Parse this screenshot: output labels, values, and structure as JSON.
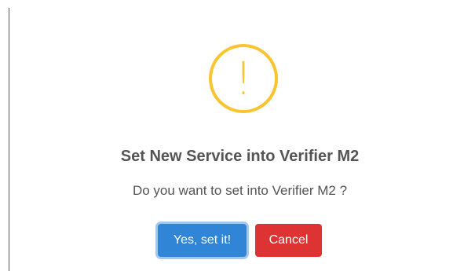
{
  "dialog": {
    "icon": "warning-exclamation-icon",
    "icon_glyph": "!",
    "title": "Set New Service into Verifier M2",
    "message": "Do you want to set into Verifier M2 ?",
    "confirm_label": "Yes, set it!",
    "cancel_label": "Cancel"
  },
  "colors": {
    "warning": "#f8c531",
    "confirm": "#3085d6",
    "cancel": "#dd3333",
    "text": "#545454"
  }
}
